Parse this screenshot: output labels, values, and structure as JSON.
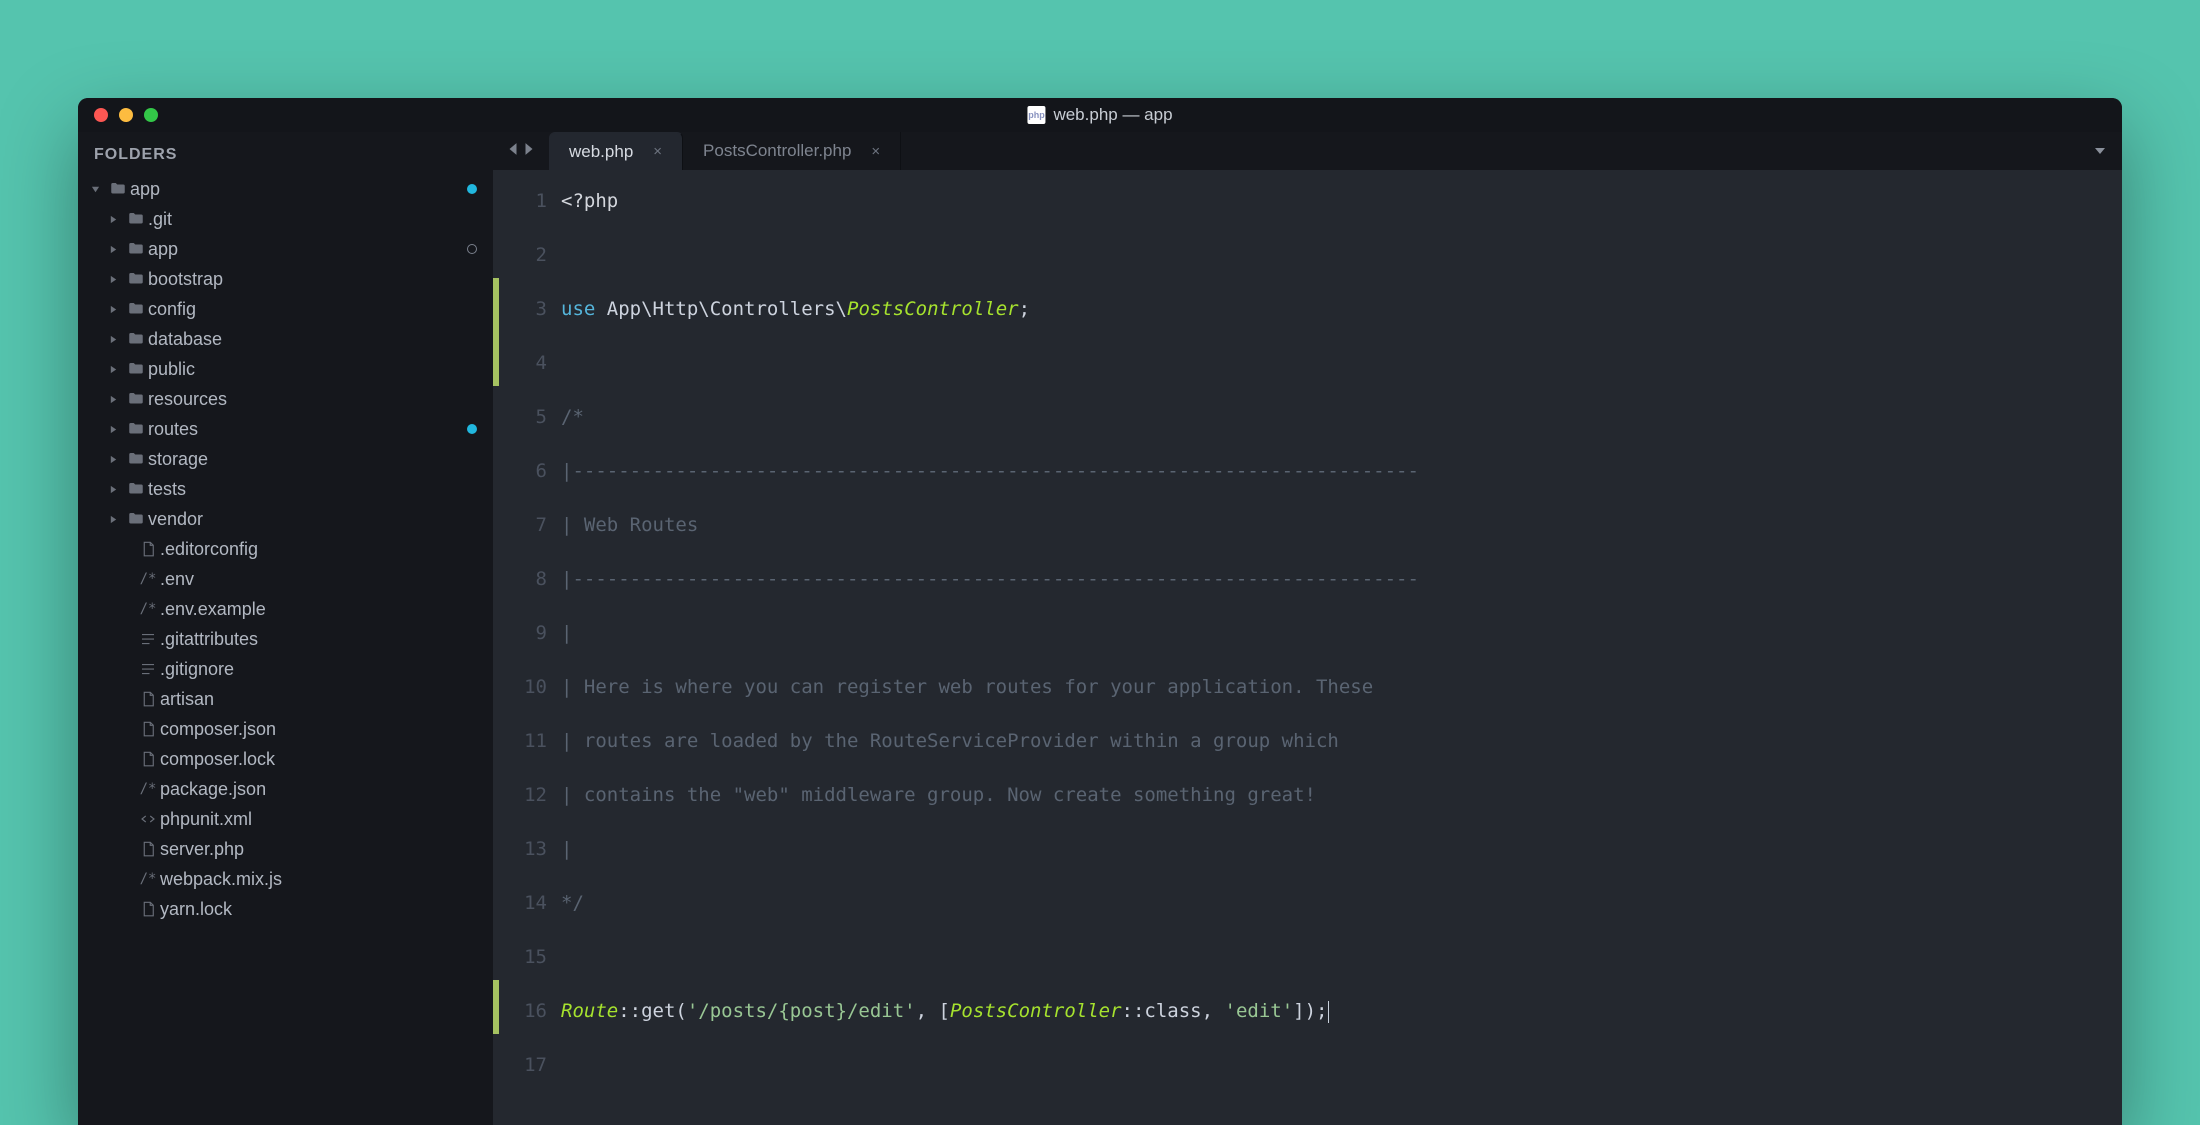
{
  "window": {
    "title": "web.php — app"
  },
  "sidebar": {
    "header": "FOLDERS",
    "root": {
      "label": "app",
      "status": "blue"
    },
    "folders": [
      {
        "label": ".git"
      },
      {
        "label": "app",
        "status": "ring"
      },
      {
        "label": "bootstrap"
      },
      {
        "label": "config"
      },
      {
        "label": "database"
      },
      {
        "label": "public"
      },
      {
        "label": "resources"
      },
      {
        "label": "routes",
        "status": "blue"
      },
      {
        "label": "storage"
      },
      {
        "label": "tests"
      },
      {
        "label": "vendor"
      }
    ],
    "files": [
      {
        "label": ".editorconfig",
        "icon": "file"
      },
      {
        "label": ".env",
        "icon": "comment"
      },
      {
        "label": ".env.example",
        "icon": "comment"
      },
      {
        "label": ".gitattributes",
        "icon": "lines"
      },
      {
        "label": ".gitignore",
        "icon": "lines"
      },
      {
        "label": "artisan",
        "icon": "file"
      },
      {
        "label": "composer.json",
        "icon": "file"
      },
      {
        "label": "composer.lock",
        "icon": "file"
      },
      {
        "label": "package.json",
        "icon": "comment"
      },
      {
        "label": "phpunit.xml",
        "icon": "code"
      },
      {
        "label": "server.php",
        "icon": "file"
      },
      {
        "label": "webpack.mix.js",
        "icon": "comment"
      },
      {
        "label": "yarn.lock",
        "icon": "file"
      }
    ]
  },
  "tabs": [
    {
      "label": "web.php",
      "active": true,
      "closeable": true
    },
    {
      "label": "PostsController.php",
      "active": false,
      "closeable": true
    }
  ],
  "code": {
    "lines": [
      {
        "n": 1,
        "mod": false,
        "seg": [
          {
            "c": "tag",
            "t": "<?php"
          }
        ]
      },
      {
        "n": 2,
        "mod": false,
        "seg": []
      },
      {
        "n": 3,
        "mod": true,
        "seg": [
          {
            "c": "key",
            "t": "use"
          },
          {
            "c": "pl",
            "t": " App\\Http\\Controllers\\"
          },
          {
            "c": "class",
            "t": "PostsController"
          },
          {
            "c": "pl",
            "t": ";"
          }
        ]
      },
      {
        "n": 4,
        "mod": true,
        "seg": []
      },
      {
        "n": 5,
        "mod": false,
        "seg": [
          {
            "c": "cm",
            "t": "/*"
          }
        ]
      },
      {
        "n": 6,
        "mod": false,
        "seg": [
          {
            "c": "cm",
            "t": "|--------------------------------------------------------------------------"
          }
        ]
      },
      {
        "n": 7,
        "mod": false,
        "seg": [
          {
            "c": "cm",
            "t": "| Web Routes"
          }
        ]
      },
      {
        "n": 8,
        "mod": false,
        "seg": [
          {
            "c": "cm",
            "t": "|--------------------------------------------------------------------------"
          }
        ]
      },
      {
        "n": 9,
        "mod": false,
        "seg": [
          {
            "c": "cm",
            "t": "|"
          }
        ]
      },
      {
        "n": 10,
        "mod": false,
        "seg": [
          {
            "c": "cm",
            "t": "| Here is where you can register web routes for your application. These"
          }
        ]
      },
      {
        "n": 11,
        "mod": false,
        "seg": [
          {
            "c": "cm",
            "t": "| routes are loaded by the RouteServiceProvider within a group which"
          }
        ]
      },
      {
        "n": 12,
        "mod": false,
        "seg": [
          {
            "c": "cm",
            "t": "| contains the \"web\" middleware group. Now create something great!"
          }
        ]
      },
      {
        "n": 13,
        "mod": false,
        "seg": [
          {
            "c": "cm",
            "t": "|"
          }
        ]
      },
      {
        "n": 14,
        "mod": false,
        "seg": [
          {
            "c": "cm",
            "t": "*/"
          }
        ]
      },
      {
        "n": 15,
        "mod": false,
        "seg": []
      },
      {
        "n": 16,
        "mod": true,
        "seg": [
          {
            "c": "route",
            "t": "Route"
          },
          {
            "c": "pl",
            "t": "::get("
          },
          {
            "c": "str",
            "t": "'/posts/{post}/edit'"
          },
          {
            "c": "pl",
            "t": ", ["
          },
          {
            "c": "cls2",
            "t": "PostsController"
          },
          {
            "c": "pl",
            "t": "::class, "
          },
          {
            "c": "str",
            "t": "'edit'"
          },
          {
            "c": "pl",
            "t": "]);"
          }
        ],
        "cursor": true
      },
      {
        "n": 17,
        "mod": false,
        "seg": []
      }
    ]
  }
}
